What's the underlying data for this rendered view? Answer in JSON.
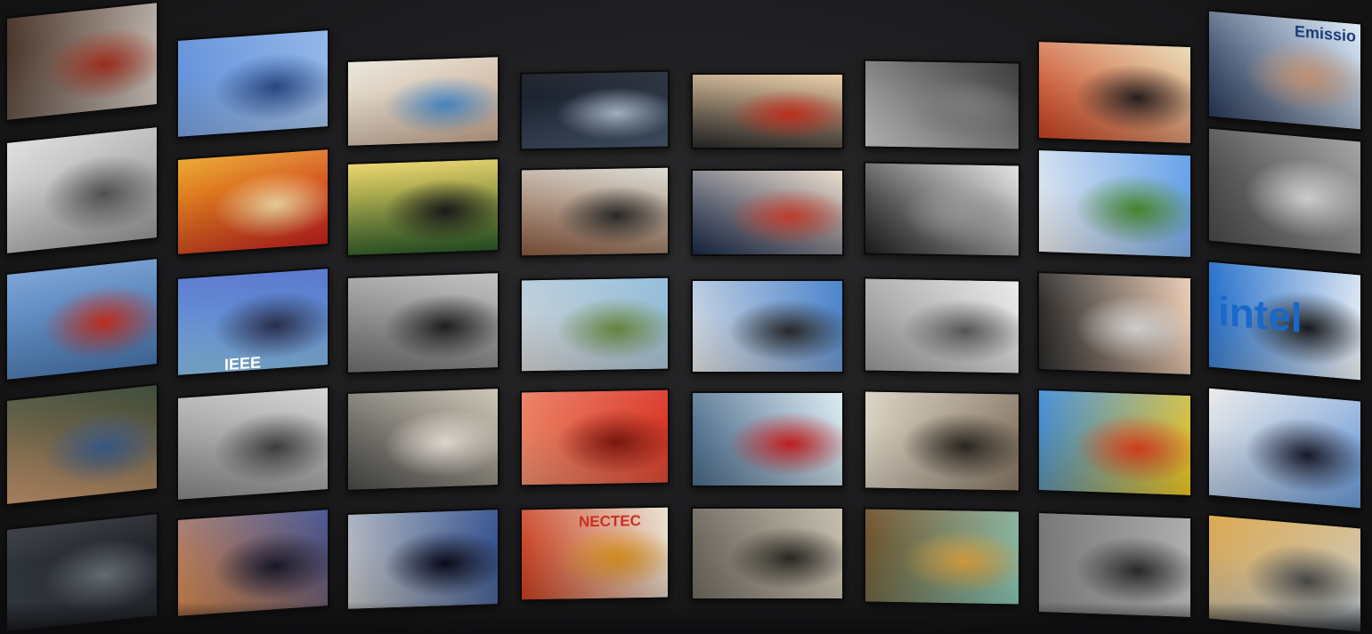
{
  "columns": [
    {
      "name": "col-1",
      "tiles": [
        {
          "name": "tile-stadium-aerial",
          "colors": [
            "#3a2418",
            "#d8d0c8",
            "#a03020"
          ]
        },
        {
          "name": "tile-vintage-engraving-cart",
          "colors": [
            "#dcdcdc",
            "#9a9a9a",
            "#555555"
          ]
        },
        {
          "name": "tile-offshore-wind-turbine",
          "colors": [
            "#6f9ad0",
            "#4a78b0",
            "#c43020"
          ]
        },
        {
          "name": "tile-smiling-man-bookshelf",
          "colors": [
            "#2a3a28",
            "#c89870",
            "#3a5a8a"
          ]
        },
        {
          "name": "tile-share-icon-screen",
          "colors": [
            "#1a1c22",
            "#3a4048",
            "#6a7078"
          ]
        }
      ]
    },
    {
      "name": "col-2",
      "tiles": [
        {
          "name": "tile-solar-plane",
          "colors": [
            "#5a8ad8",
            "#a8c8f0",
            "#2a4a88"
          ]
        },
        {
          "name": "tile-robot-dancer",
          "colors": [
            "#e8a020",
            "#c82020",
            "#f0d8a0"
          ]
        },
        {
          "name": "tile-ieee-speaker",
          "colors": [
            "#4a6ac8",
            "#8ac0e8",
            "#2a3050"
          ],
          "text": "IEEE"
        },
        {
          "name": "tile-lab-robots-bw",
          "colors": [
            "#d0d0d0",
            "#888888",
            "#404040"
          ]
        },
        {
          "name": "tile-rocket-sunset",
          "colors": [
            "#3a4a8a",
            "#d88a50",
            "#1a1a2a"
          ]
        }
      ]
    },
    {
      "name": "col-3",
      "tiles": [
        {
          "name": "tile-scientist-rings",
          "colors": [
            "#e8e4d8",
            "#c8a890",
            "#4a8ac8"
          ]
        },
        {
          "name": "tile-circuit-chip",
          "colors": [
            "#e8d060",
            "#2a5a28",
            "#1a1a1a"
          ]
        },
        {
          "name": "tile-engineer-bw",
          "colors": [
            "#bcbcbc",
            "#707070",
            "#202020"
          ]
        },
        {
          "name": "tile-woman-subway",
          "colors": [
            "#c8c0b0",
            "#4a4a48",
            "#e8e0d8"
          ]
        },
        {
          "name": "tile-satellite-orbit",
          "colors": [
            "#2a4a8a",
            "#c8c8c8",
            "#0a0a1a"
          ]
        }
      ]
    },
    {
      "name": "col-4",
      "tiles": [
        {
          "name": "tile-hand-scan",
          "colors": [
            "#0a0e18",
            "#4a5a70",
            "#aab8c8"
          ]
        },
        {
          "name": "tile-bearded-man-glasses",
          "colors": [
            "#d8d8d0",
            "#8a5a40",
            "#2a2a28"
          ]
        },
        {
          "name": "tile-rocket-model",
          "colors": [
            "#8ab8d8",
            "#d8d8d8",
            "#6a8a40"
          ]
        },
        {
          "name": "tile-petri-dishes",
          "colors": [
            "#d83020",
            "#f09070",
            "#801810"
          ]
        },
        {
          "name": "tile-nectec-booth",
          "colors": [
            "#e8e0d0",
            "#c84020",
            "#d89020"
          ],
          "text": "NECTEC"
        }
      ]
    },
    {
      "name": "col-5",
      "tiles": [
        {
          "name": "tile-man-children",
          "colors": [
            "#e8c8a0",
            "#2a2a2a",
            "#c83020"
          ]
        },
        {
          "name": "tile-bench-room",
          "colors": [
            "#e8d8c8",
            "#1a2a4a",
            "#c84030"
          ]
        },
        {
          "name": "tile-cheering-man",
          "colors": [
            "#3a78c8",
            "#e8e8e8",
            "#2a2a2a"
          ]
        },
        {
          "name": "tile-ocean-waves",
          "colors": [
            "#d8e8f0",
            "#4a6a8a",
            "#c82020"
          ]
        },
        {
          "name": "tile-old-lab-bw",
          "colors": [
            "#c8c0b0",
            "#6a645a",
            "#2a2822"
          ]
        }
      ]
    },
    {
      "name": "col-6",
      "tiles": [
        {
          "name": "tile-old-scientist-bw",
          "colors": [
            "#2a2a2a",
            "#d0d0d0",
            "#808080"
          ]
        },
        {
          "name": "tile-walking-robots",
          "colors": [
            "#e0e0e0",
            "#202020",
            "#9a9a9a"
          ]
        },
        {
          "name": "tile-blueprint-drawing",
          "colors": [
            "#e8e8e8",
            "#9a9a9a",
            "#5a5a5a"
          ]
        },
        {
          "name": "tile-marconi-portrait",
          "colors": [
            "#8a7a68",
            "#d8d0c0",
            "#2a2620"
          ]
        },
        {
          "name": "tile-portrait-gallery",
          "colors": [
            "#8ac8b8",
            "#6a4a20",
            "#d8a040"
          ]
        }
      ]
    },
    {
      "name": "col-7",
      "tiles": [
        {
          "name": "tile-poster-exhibit",
          "colors": [
            "#e8d8b0",
            "#c84020",
            "#2a2020"
          ]
        },
        {
          "name": "tile-wind-farm",
          "colors": [
            "#5a9ae8",
            "#f0f0f0",
            "#4a8a30"
          ]
        },
        {
          "name": "tile-hands-screen",
          "colors": [
            "#e8c8b0",
            "#2a2a2a",
            "#d8d8d8"
          ]
        },
        {
          "name": "tile-hand-device-colorful",
          "colors": [
            "#f0c820",
            "#3a88d8",
            "#d84020"
          ]
        },
        {
          "name": "tile-steamship-bw",
          "colors": [
            "#c8c8c8",
            "#6a6a6a",
            "#2a2a2a"
          ]
        }
      ]
    },
    {
      "name": "col-8",
      "tiles": [
        {
          "name": "tile-speaker-emission",
          "colors": [
            "#d8e8f8",
            "#2a3a5a",
            "#c89878"
          ],
          "text": "Emissio"
        },
        {
          "name": "tile-moon-surface",
          "colors": [
            "#9a9a9a",
            "#4a4a4a",
            "#d8d8d8"
          ]
        },
        {
          "name": "tile-intel-logo",
          "colors": [
            "#f4f6f8",
            "#1a68c8",
            "#1a1a1a"
          ],
          "text": "intel"
        },
        {
          "name": "tile-space-station",
          "colors": [
            "#6a9ad8",
            "#e8e8e8",
            "#1a1a2a"
          ]
        },
        {
          "name": "tile-construction-site",
          "colors": [
            "#c8d8e8",
            "#d8a040",
            "#4a4a4a"
          ]
        }
      ]
    }
  ]
}
